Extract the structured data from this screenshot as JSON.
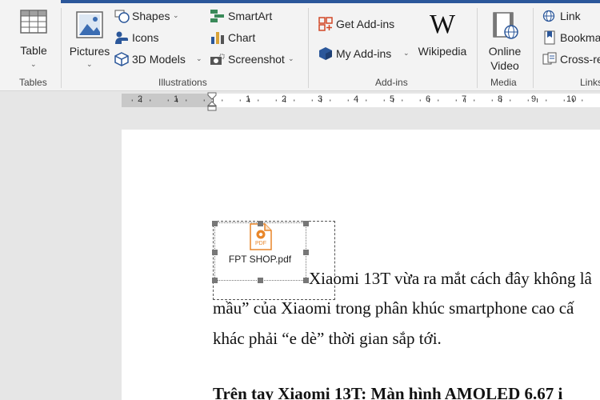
{
  "ribbon": {
    "groups": {
      "tables": "Tables",
      "illustrations": "Illustrations",
      "addins": "Add-ins",
      "media": "Media",
      "links": "Links"
    },
    "buttons": {
      "table": "Table",
      "pictures": "Pictures",
      "shapes": "Shapes",
      "icons": "Icons",
      "models3d": "3D Models",
      "smartart": "SmartArt",
      "chart": "Chart",
      "screenshot": "Screenshot",
      "get_addins": "Get Add-ins",
      "my_addins": "My Add-ins",
      "wikipedia": "Wikipedia",
      "wikipedia_glyph": "W",
      "online_video_1": "Online",
      "online_video_2": "Video",
      "link": "Link",
      "bookmark": "Bookmar",
      "cross_ref": "Cross-re"
    },
    "icons": [
      "table-icon",
      "pictures-icon",
      "shapes-icon",
      "icons-icon",
      "3d-models-icon",
      "smartart-icon",
      "chart-icon",
      "screenshot-icon",
      "store-icon",
      "my-addins-icon",
      "wikipedia-icon",
      "online-video-icon",
      "link-icon",
      "bookmark-icon",
      "cross-reference-icon"
    ]
  },
  "ruler": {
    "labels": [
      "2",
      "1",
      "1",
      "2",
      "3",
      "4",
      "5",
      "6",
      "7",
      "8",
      "9",
      "10"
    ]
  },
  "document": {
    "object_caption": "FPT SHOP.pdf",
    "pdf_badge": "PDF",
    "line1": "Xiaomi 13T vừa ra mắt cách đây không lâ",
    "line2": "mầu” của Xiaomi trong phân khúc smartphone cao cấ",
    "line3": "khác phải “e dè” thời gian sắp tới.",
    "heading": "Trên tay Xiaomi 13T: Màn hình AMOLED 6.67 i"
  },
  "colors": {
    "accent": "#2b579a",
    "pdf_orange": "#e8862a",
    "addin_red": "#d24726",
    "addin_blue": "#2b579a"
  }
}
